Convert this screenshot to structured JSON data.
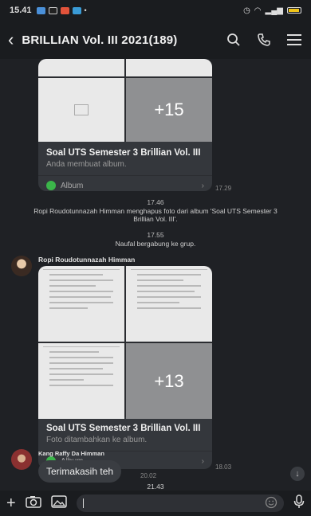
{
  "status_bar": {
    "time": "15.41"
  },
  "header": {
    "title": "BRILLIAN Vol. III 2021(189)"
  },
  "album1": {
    "more_count": "+15",
    "title": "Soal UTS Semester 3 Brillian Vol. III",
    "subtitle": "Anda membuat album.",
    "footer_label": "Album",
    "timestamp": "17.29"
  },
  "system1": {
    "time": "17.46",
    "text": "Ropi Roudotunnazah Himman menghapus foto dari album 'Soal UTS Semester 3 Brillian Vol. III'."
  },
  "system2": {
    "time": "17.55",
    "text": "Naufal bergabung ke grup."
  },
  "album2": {
    "sender": "Ropi Roudotunnazah Himman",
    "more_count": "+13",
    "title": "Soal UTS Semester 3 Brillian Vol. III",
    "subtitle": "Foto ditambahkan ke album.",
    "footer_label": "Album",
    "timestamp": "18.03"
  },
  "message1": {
    "sender": "Kang Raffy Da Himman",
    "text": "Terimakasih teh",
    "timestamp": "20.02"
  },
  "date_divider": "21.43",
  "colors": {
    "background": "#1f2125",
    "bar": "#1a1c1f",
    "card": "#34373c",
    "album_badge": "#3bb54a"
  }
}
